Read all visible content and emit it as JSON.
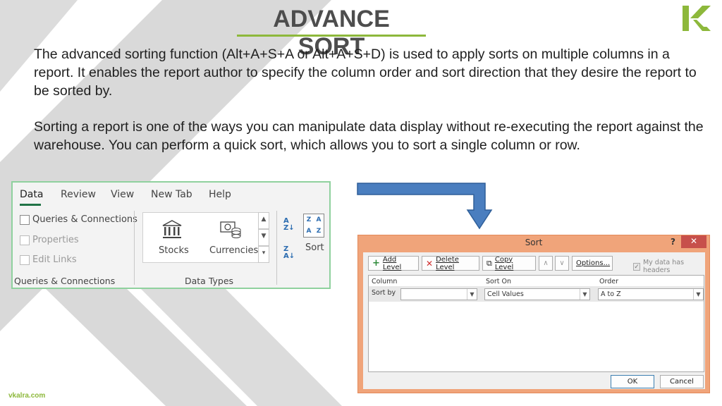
{
  "slide": {
    "title": "ADVANCE SORT",
    "accent_color": "#8db83b",
    "paragraphs": [
      "The advanced sorting function (Alt+A+S+A or Alt+A+S+D) is used to apply sorts on multiple columns in a report. It enables the report author to specify the column order and sort direction that they desire the report to be sorted by.",
      "Sorting a report is one of the ways you can manipulate data display without re-executing the report against the warehouse. You can perform a quick sort, which allows you to sort a single column or row."
    ],
    "footer": "vkalra.com"
  },
  "ribbon": {
    "tabs": [
      "Data",
      "Review",
      "View",
      "New Tab",
      "Help"
    ],
    "active_tab": "Data",
    "queries_group": {
      "items": [
        "Queries & Connections",
        "Properties",
        "Edit Links"
      ],
      "label": "Queries & Connections"
    },
    "data_types_group": {
      "items": [
        "Stocks",
        "Currencies"
      ],
      "label": "Data Types"
    },
    "sort_label": "Sort",
    "sort_az_icon": "sort-a-to-z-icon",
    "sort_za_icon": "sort-z-to-a-icon"
  },
  "dialog": {
    "title": "Sort",
    "help": "?",
    "close": "✕",
    "toolbar": {
      "add_level": "Add Level",
      "delete_level": "Delete Level",
      "copy_level": "Copy Level",
      "options": "Options...",
      "my_data_has_headers": "My data has headers",
      "headers_checked": true
    },
    "columns": [
      "Column",
      "Sort On",
      "Order"
    ],
    "row": {
      "label": "Sort by",
      "column_value": "",
      "sort_on_value": "Cell Values",
      "order_value": "A to Z"
    },
    "ok": "OK",
    "cancel": "Cancel",
    "border_color": "#f0a47a"
  }
}
